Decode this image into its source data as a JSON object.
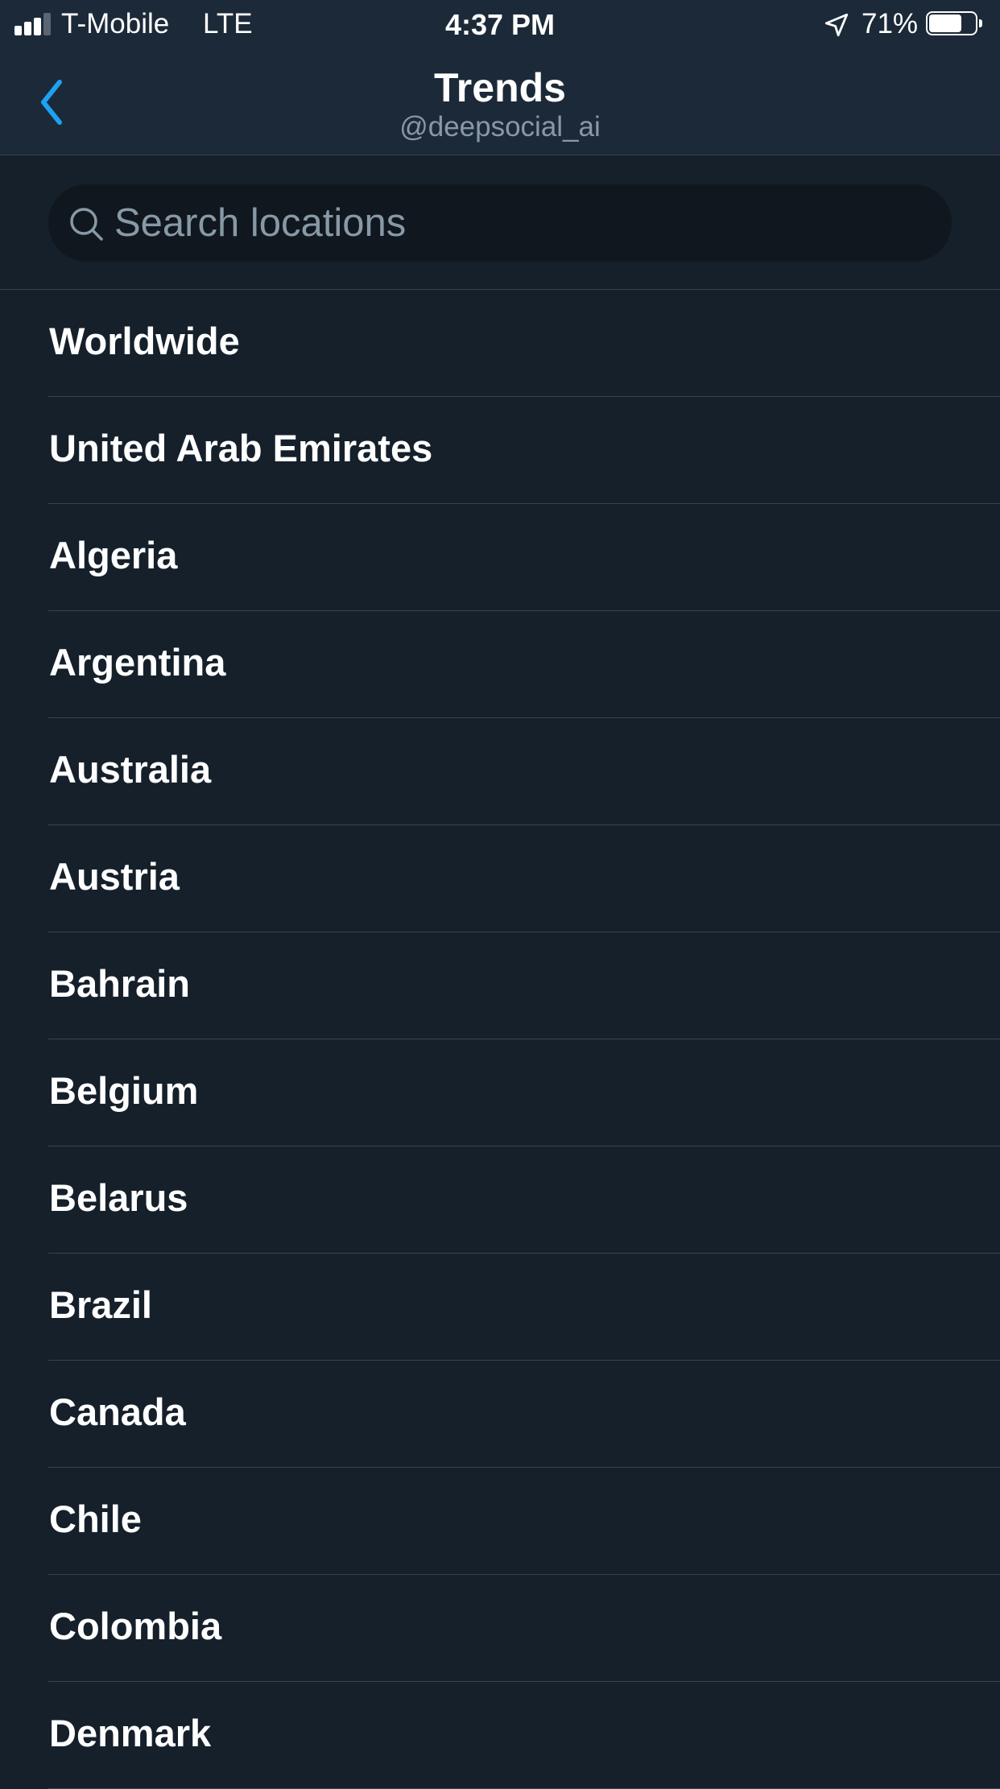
{
  "status_bar": {
    "carrier": "T-Mobile",
    "network": "LTE",
    "time": "4:37 PM",
    "battery_percent": "71%",
    "battery_level": 0.71,
    "signal_bars_filled": 3,
    "signal_bars_total": 4
  },
  "nav": {
    "title": "Trends",
    "subtitle": "@deepsocial_ai",
    "back_icon": "chevron-left-icon"
  },
  "search": {
    "placeholder": "Search locations",
    "value": "",
    "icon": "search-icon"
  },
  "locations": [
    {
      "label": "Worldwide"
    },
    {
      "label": "United Arab Emirates"
    },
    {
      "label": "Algeria"
    },
    {
      "label": "Argentina"
    },
    {
      "label": "Australia"
    },
    {
      "label": "Austria"
    },
    {
      "label": "Bahrain"
    },
    {
      "label": "Belgium"
    },
    {
      "label": "Belarus"
    },
    {
      "label": "Brazil"
    },
    {
      "label": "Canada"
    },
    {
      "label": "Chile"
    },
    {
      "label": "Colombia"
    },
    {
      "label": "Denmark"
    }
  ],
  "colors": {
    "background": "#15202b",
    "header": "#1c2938",
    "accent": "#1da1f2",
    "secondary_text": "#8899a6",
    "divider": "#38444d"
  }
}
